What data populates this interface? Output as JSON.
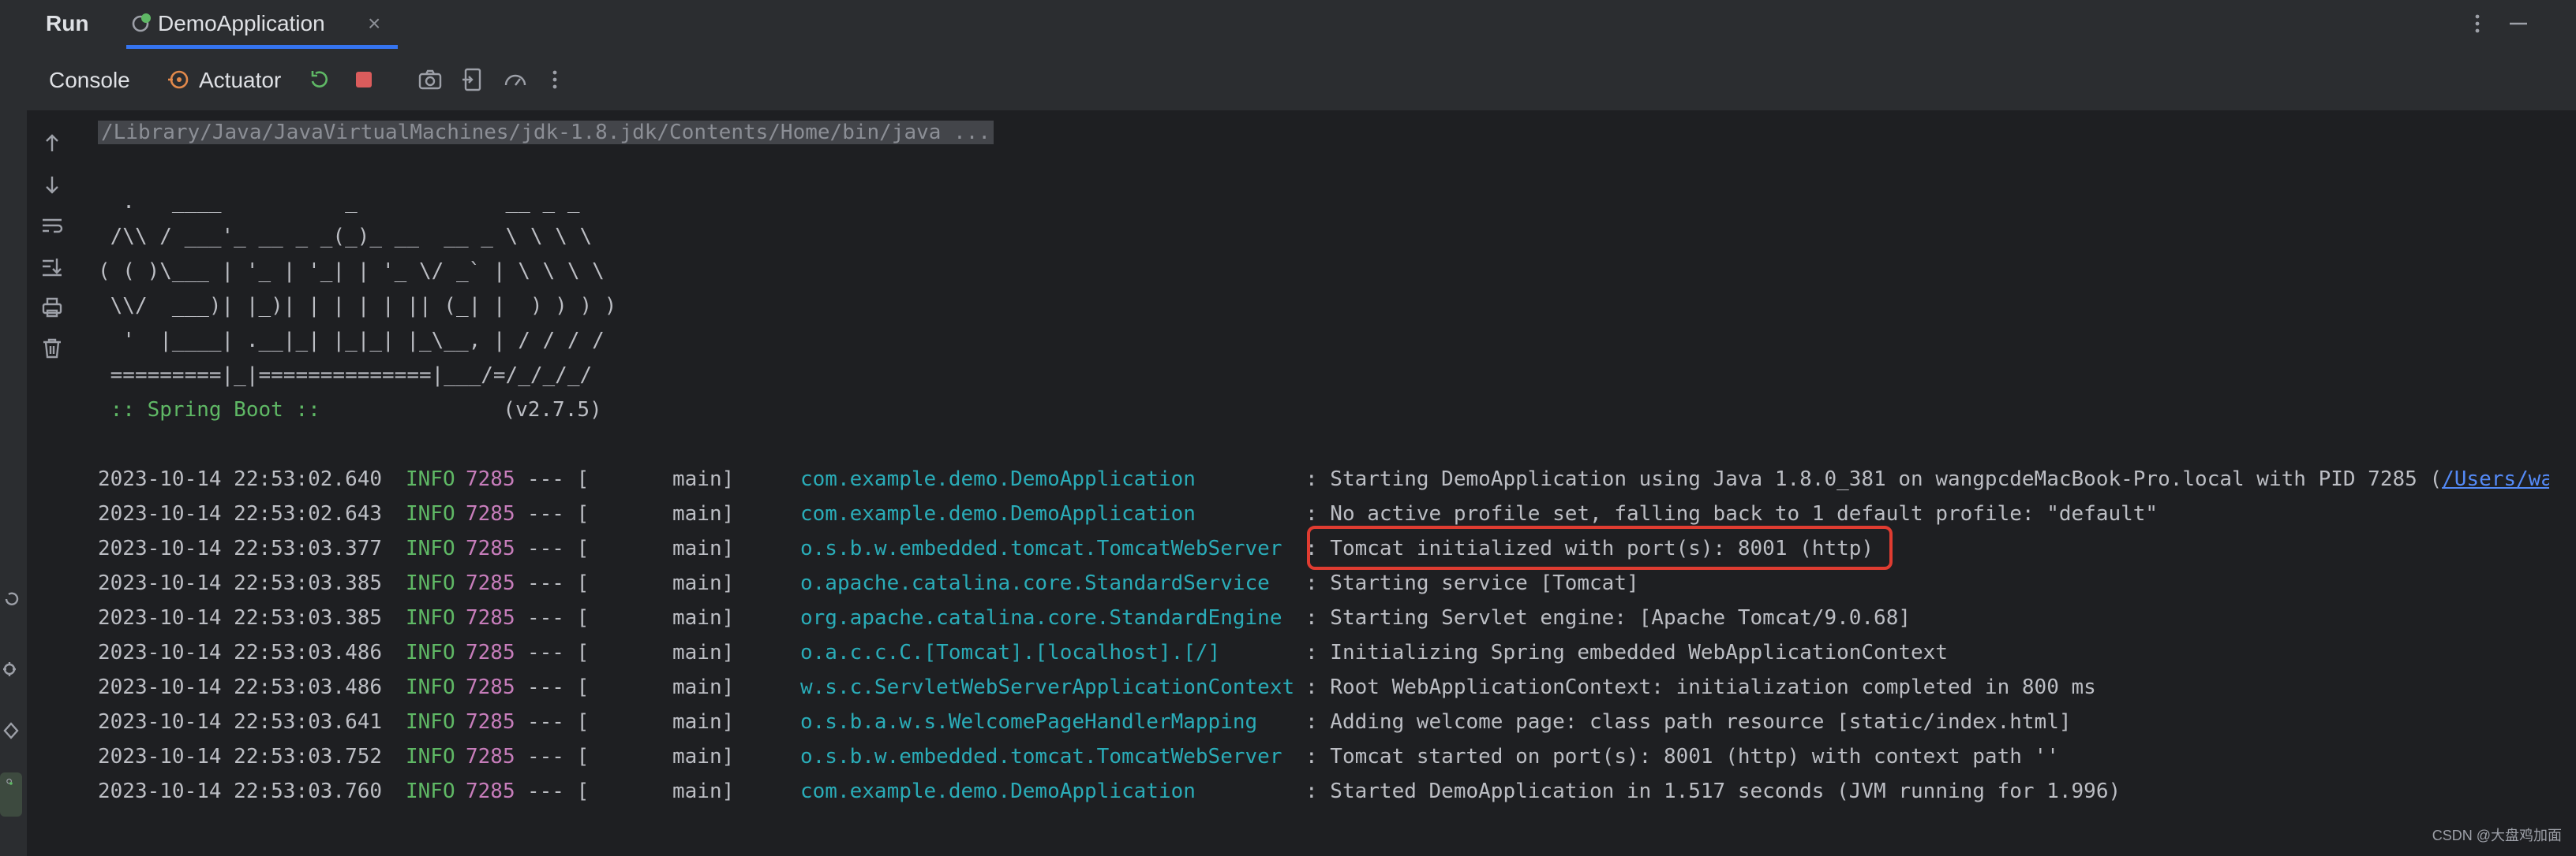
{
  "colors": {
    "accent": "#3574f0",
    "info": "#5fb865",
    "pid": "#c77dbb",
    "logger": "#2aacb8",
    "highlight": "#e03c31"
  },
  "topbar": {
    "title": "Run",
    "tab_label": "DemoApplication",
    "tab_close": "×"
  },
  "toolbar": {
    "console_label": "Console",
    "actuator_label": "Actuator"
  },
  "icons": [
    "rerun-icon",
    "stop-icon",
    "camera-icon",
    "exit-icon",
    "speed-icon",
    "more-icon",
    "scroll-up-icon",
    "scroll-down-icon",
    "soft-wrap-icon",
    "scroll-to-end-icon",
    "print-icon",
    "trash-icon"
  ],
  "console": {
    "command": "/Library/Java/JavaVirtualMachines/jdk-1.8.jdk/Contents/Home/bin/java ...",
    "banner": [
      "  .   ____          _            __ _ _",
      " /\\\\ / ___'_ __ _ _(_)_ __  __ _ \\ \\ \\ \\",
      "( ( )\\___ | '_ | '_| | '_ \\/ _` | \\ \\ \\ \\",
      " \\\\/  ___)| |_)| | | | | || (_| |  ) ) ) )",
      "  '  |____| .__|_| |_|_| |_\\__, | / / / /",
      " =========|_|==============|___/=/_/_/_/"
    ],
    "banner_label": " :: Spring Boot :: ",
    "banner_version": "(v2.7.5)",
    "log": [
      {
        "ts": "2023-10-14 22:53:02.640",
        "level": "INFO",
        "pid": "7285",
        "sep": "--- [",
        "thread": "main]",
        "logger": "com.example.demo.DemoApplication",
        "msg": ": Starting DemoApplication using Java 1.8.0_381 on wangpcdeMacBook-Pro.local with PID 7285 (",
        "link": "/Users/wan"
      },
      {
        "ts": "2023-10-14 22:53:02.643",
        "level": "INFO",
        "pid": "7285",
        "sep": "--- [",
        "thread": "main]",
        "logger": "com.example.demo.DemoApplication",
        "msg": ": No active profile set, falling back to 1 default profile: \"default\""
      },
      {
        "ts": "2023-10-14 22:53:03.377",
        "level": "INFO",
        "pid": "7285",
        "sep": "--- [",
        "thread": "main]",
        "logger": "o.s.b.w.embedded.tomcat.TomcatWebServer",
        "msg": ": Tomcat initialized with port(s): 8001 (http)"
      },
      {
        "ts": "2023-10-14 22:53:03.385",
        "level": "INFO",
        "pid": "7285",
        "sep": "--- [",
        "thread": "main]",
        "logger": "o.apache.catalina.core.StandardService",
        "msg": ": Starting service [Tomcat]"
      },
      {
        "ts": "2023-10-14 22:53:03.385",
        "level": "INFO",
        "pid": "7285",
        "sep": "--- [",
        "thread": "main]",
        "logger": "org.apache.catalina.core.StandardEngine",
        "msg": ": Starting Servlet engine: [Apache Tomcat/9.0.68]"
      },
      {
        "ts": "2023-10-14 22:53:03.486",
        "level": "INFO",
        "pid": "7285",
        "sep": "--- [",
        "thread": "main]",
        "logger": "o.a.c.c.C.[Tomcat].[localhost].[/]",
        "msg": ": Initializing Spring embedded WebApplicationContext"
      },
      {
        "ts": "2023-10-14 22:53:03.486",
        "level": "INFO",
        "pid": "7285",
        "sep": "--- [",
        "thread": "main]",
        "logger": "w.s.c.ServletWebServerApplicationContext",
        "msg": ": Root WebApplicationContext: initialization completed in 800 ms"
      },
      {
        "ts": "2023-10-14 22:53:03.641",
        "level": "INFO",
        "pid": "7285",
        "sep": "--- [",
        "thread": "main]",
        "logger": "o.s.b.a.w.s.WelcomePageHandlerMapping",
        "msg": ": Adding welcome page: class path resource [static/index.html]"
      },
      {
        "ts": "2023-10-14 22:53:03.752",
        "level": "INFO",
        "pid": "7285",
        "sep": "--- [",
        "thread": "main]",
        "logger": "o.s.b.w.embedded.tomcat.TomcatWebServer",
        "msg": ": Tomcat started on port(s): 8001 (http) with context path ''"
      },
      {
        "ts": "2023-10-14 22:53:03.760",
        "level": "INFO",
        "pid": "7285",
        "sep": "--- [",
        "thread": "main]",
        "logger": "com.example.demo.DemoApplication",
        "msg": ": Started DemoApplication in 1.517 seconds (JVM running for 1.996)"
      }
    ]
  },
  "watermark": "CSDN @大盘鸡加面"
}
